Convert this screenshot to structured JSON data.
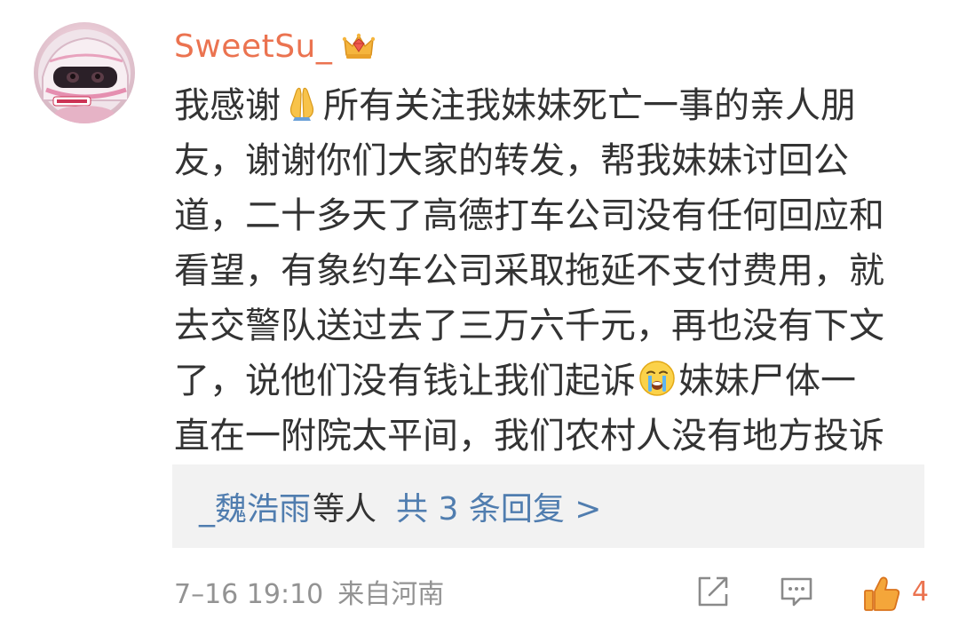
{
  "comment": {
    "username": "SweetSu_",
    "badge_icon": "crown-gem-icon",
    "lines": [
      {
        "before": "我感谢",
        "emoji": "folded-hands-emoji",
        "after": "所有关注我妹妹死亡一事的亲人朋"
      },
      {
        "text": "友，谢谢你们大家的转发，帮我妹妹讨回公"
      },
      {
        "text": "道，二十多天了高德打车公司没有任何回应和"
      },
      {
        "text": "看望，有象约车公司采取拖延不支付费用，就"
      },
      {
        "text": "去交警队送过去了三万六千元，再也没有下文"
      },
      {
        "before": "了，说他们没有钱让我们起诉",
        "emoji": "crying-face-emoji",
        "after": "妹妹尸体一"
      },
      {
        "text": "直在一附院太平间，我们农村人没有地方投诉"
      }
    ],
    "replies": {
      "user": "_魏浩雨",
      "others": "等人",
      "total": "共 3 条回复 >"
    },
    "footer": {
      "time": "7–16 19:10",
      "source": "来自河南",
      "like_count": "4"
    }
  },
  "colors": {
    "username": "#eb7350",
    "link": "#507daf",
    "text": "#333333",
    "meta": "#939393",
    "reply_bg": "#f2f2f2",
    "like": "#eb7350"
  }
}
